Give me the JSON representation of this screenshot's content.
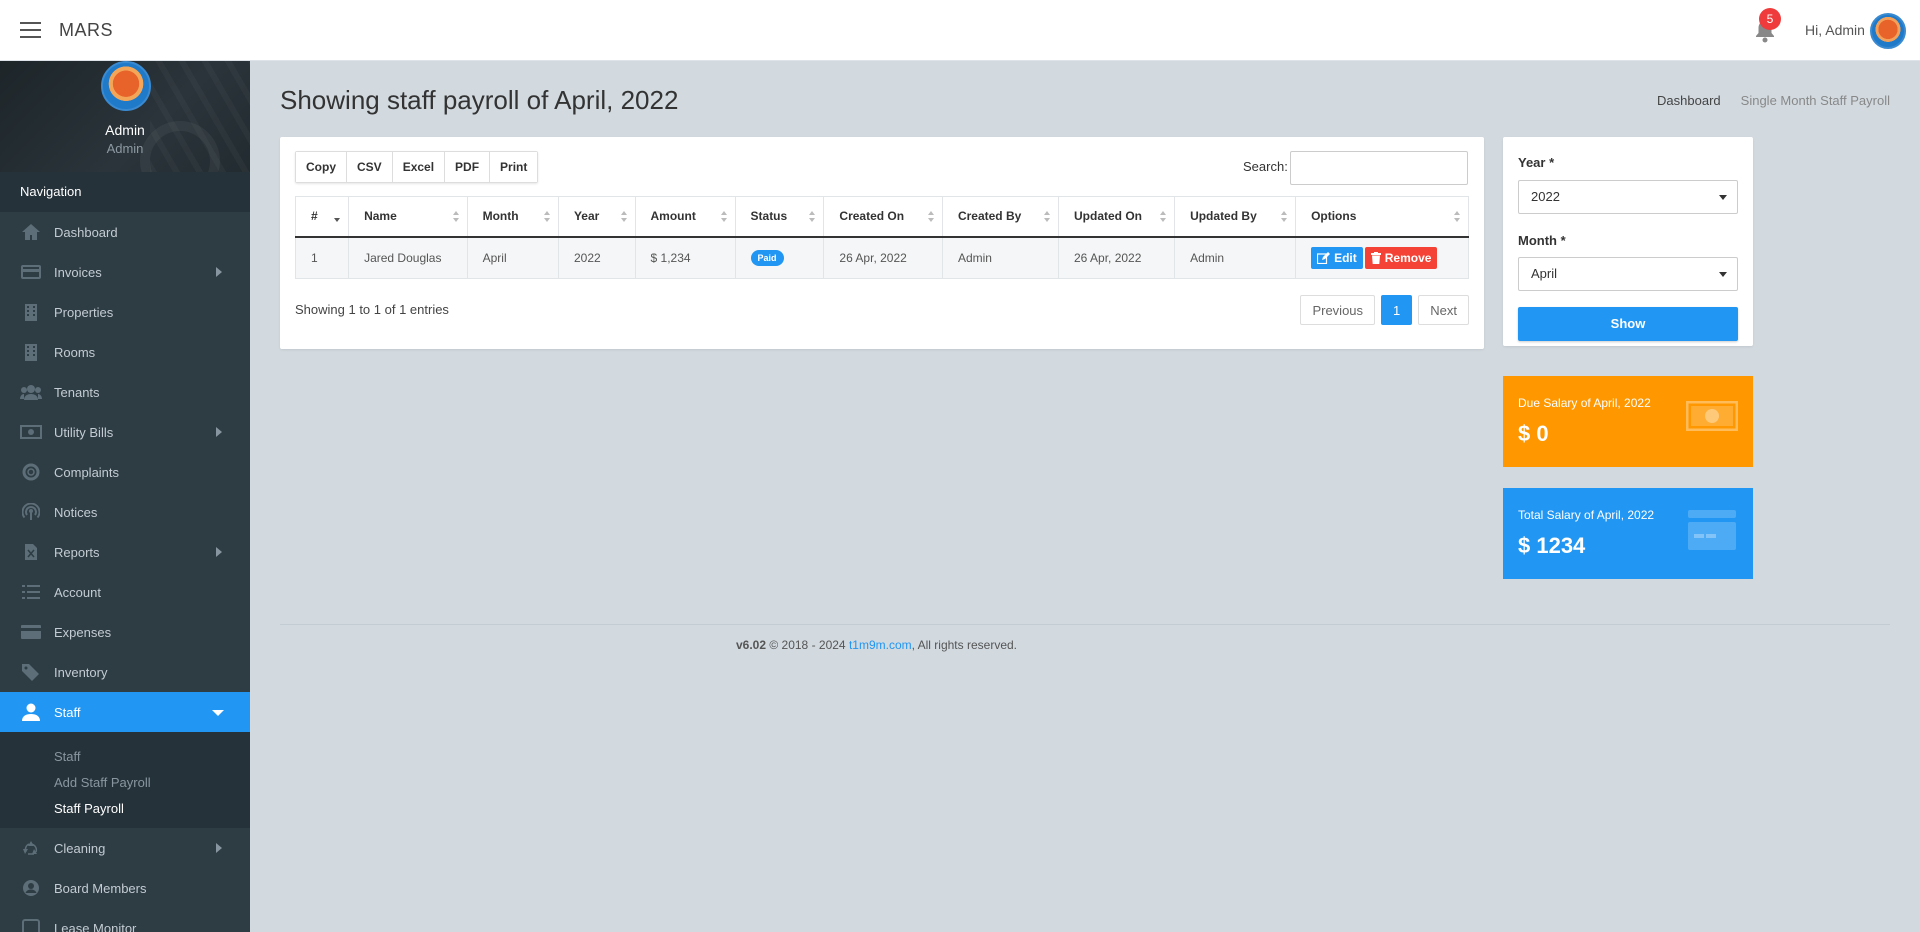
{
  "header": {
    "brand": "MARS",
    "notification_count": "5",
    "greeting": "Hi, Admin"
  },
  "sidebar": {
    "profile_name": "Admin",
    "profile_role": "Admin",
    "nav_heading": "Navigation",
    "items": [
      {
        "label": "Dashboard",
        "icon": "home-icon",
        "has_submenu": false
      },
      {
        "label": "Invoices",
        "icon": "invoice-icon",
        "has_submenu": true
      },
      {
        "label": "Properties",
        "icon": "building-icon",
        "has_submenu": false
      },
      {
        "label": "Rooms",
        "icon": "building-icon",
        "has_submenu": false
      },
      {
        "label": "Tenants",
        "icon": "users-icon",
        "has_submenu": false
      },
      {
        "label": "Utility Bills",
        "icon": "money-icon",
        "has_submenu": true
      },
      {
        "label": "Complaints",
        "icon": "support-icon",
        "has_submenu": false
      },
      {
        "label": "Notices",
        "icon": "broadcast-icon",
        "has_submenu": false
      },
      {
        "label": "Reports",
        "icon": "file-excel-icon",
        "has_submenu": true
      },
      {
        "label": "Account",
        "icon": "list-icon",
        "has_submenu": false
      },
      {
        "label": "Expenses",
        "icon": "credit-card-icon",
        "has_submenu": false
      },
      {
        "label": "Inventory",
        "icon": "tag-icon",
        "has_submenu": false
      },
      {
        "label": "Staff",
        "icon": "user-icon",
        "has_submenu": true,
        "active": true
      }
    ],
    "staff_submenu": [
      {
        "label": "Staff",
        "current": false
      },
      {
        "label": "Add Staff Payroll",
        "current": false
      },
      {
        "label": "Staff Payroll",
        "current": true
      }
    ],
    "items_after": [
      {
        "label": "Cleaning",
        "icon": "recycle-icon",
        "has_submenu": true
      },
      {
        "label": "Board Members",
        "icon": "user-circle-icon",
        "has_submenu": false
      },
      {
        "label": "Lease Monitor",
        "icon": "square-icon",
        "has_submenu": false
      }
    ]
  },
  "page": {
    "title": "Showing staff payroll of April, 2022",
    "breadcrumb": [
      "Dashboard",
      "Single Month Staff Payroll"
    ]
  },
  "table": {
    "export_buttons": [
      "Copy",
      "CSV",
      "Excel",
      "PDF",
      "Print"
    ],
    "search_label": "Search:",
    "search_value": "",
    "columns": [
      "#",
      "Name",
      "Month",
      "Year",
      "Amount",
      "Status",
      "Created On",
      "Created By",
      "Updated On",
      "Updated By",
      "Options"
    ],
    "rows": [
      {
        "num": "1",
        "name": "Jared Douglas",
        "month": "April",
        "year": "2022",
        "amount": "$ 1,234",
        "status": "Paid",
        "created_on": "26 Apr, 2022",
        "created_by": "Admin",
        "updated_on": "26 Apr, 2022",
        "updated_by": "Admin",
        "edit_label": "Edit",
        "remove_label": "Remove"
      }
    ],
    "info": "Showing 1 to 1 of 1 entries",
    "pagination": {
      "previous": "Previous",
      "current": "1",
      "next": "Next"
    }
  },
  "filter": {
    "year_label": "Year *",
    "year_value": "2022",
    "month_label": "Month *",
    "month_value": "April",
    "show_label": "Show"
  },
  "stats": {
    "due_label": "Due Salary of April, 2022",
    "due_value": "$ 0",
    "total_label": "Total Salary of April, 2022",
    "total_value": "$ 1234"
  },
  "footer": {
    "version": "v6.02",
    "copyright": "© 2018 - 2024",
    "link": "t1m9m.com",
    "rights": ", All rights reserved."
  },
  "colors": {
    "primary": "#2196f3",
    "danger": "#f44336",
    "warning": "#ff9800",
    "sidebar_bg": "#2e3c44",
    "page_bg": "#d2dae0"
  }
}
